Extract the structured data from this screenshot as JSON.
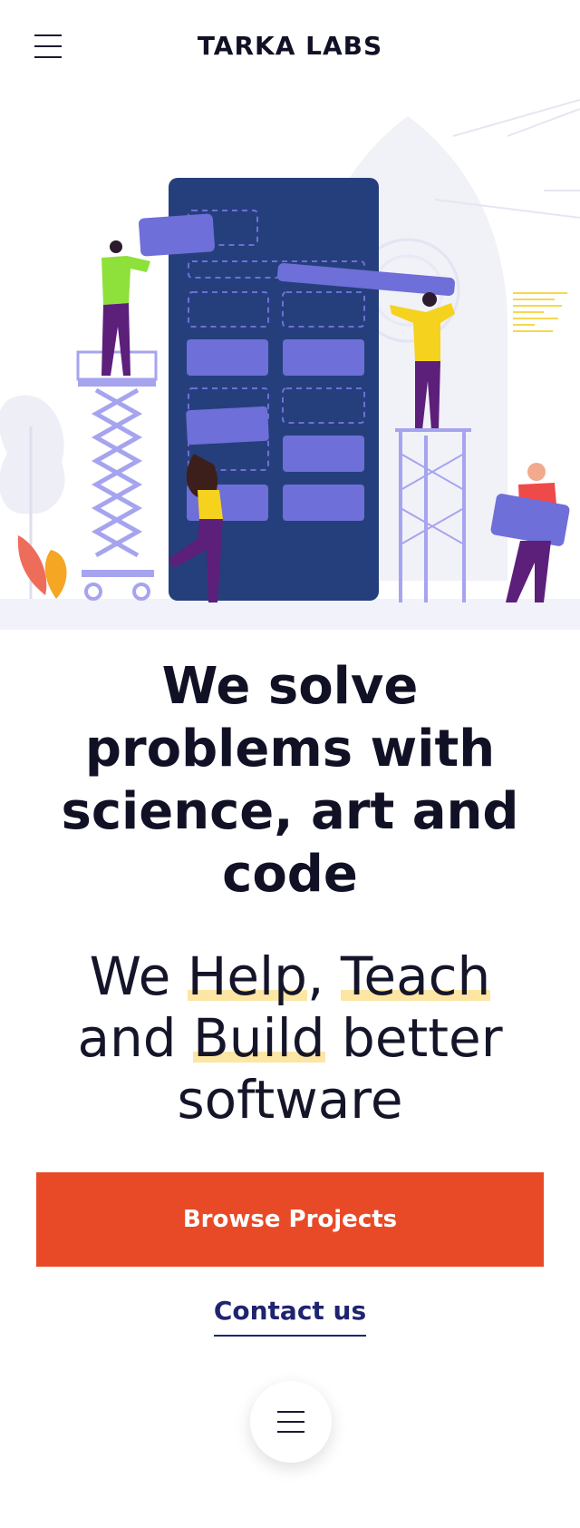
{
  "header": {
    "logo_text": "TARKA LABS",
    "menu_icon": "hamburger-menu-icon"
  },
  "hero": {
    "illustration": "team-building-software-illustration"
  },
  "main": {
    "headline": "We solve problems with science, art and code",
    "tagline": {
      "part1": "We ",
      "help": "Help",
      "comma": ", ",
      "teach": "Teach",
      "part2": " and ",
      "build": "Build",
      "part3": " better software"
    },
    "browse_label": "Browse Projects",
    "contact_label": "Contact us"
  },
  "fab": {
    "icon": "hamburger-menu-icon"
  },
  "colors": {
    "accent": "#e84a27",
    "link": "#1f2470",
    "highlight": "#fde6a3",
    "board": "#253f7c",
    "block": "#6e6fd8"
  }
}
